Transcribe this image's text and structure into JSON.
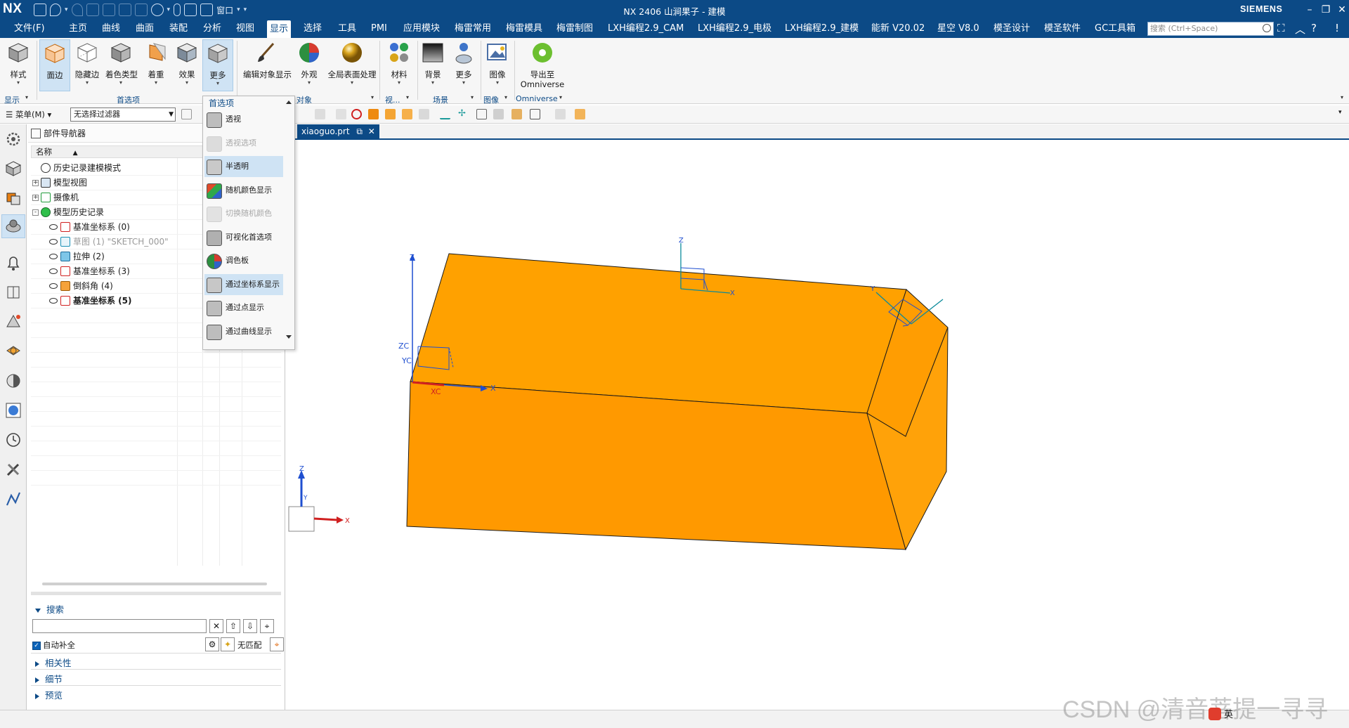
{
  "app": {
    "logo": "NX",
    "window_title": "NX 2406 山涧果子 - 建模",
    "brand": "SIEMENS",
    "window_menu": "窗口"
  },
  "menubar": {
    "items": [
      "文件(F)",
      "主页",
      "曲线",
      "曲面",
      "装配",
      "分析",
      "视图",
      "显示",
      "选择",
      "工具",
      "PMI",
      "应用模块",
      "梅雷常用",
      "梅雷模具",
      "梅雷制图",
      "LXH编程2.9_CAM",
      "LXH编程2.9_电极",
      "LXH编程2.9_建模",
      "能新 V20.02",
      "星空 V8.0",
      "模圣设计",
      "模圣软件",
      "GC工具箱"
    ],
    "active_index": 7,
    "search_placeholder": "搜索 (Ctrl+Space)"
  },
  "ribbon": {
    "buttons": [
      {
        "label": "样式",
        "icon": "style-cube-icon"
      },
      {
        "label": "面边",
        "icon": "face-edge-icon"
      },
      {
        "label": "隐藏边",
        "icon": "hidden-edge-icon"
      },
      {
        "label": "着色类型",
        "icon": "shading-type-icon"
      },
      {
        "label": "着重",
        "icon": "emphasis-icon"
      },
      {
        "label": "效果",
        "icon": "effects-icon"
      },
      {
        "label": "更多",
        "icon": "more-cube-icon"
      },
      {
        "label": "编辑对象显示",
        "icon": "brush-icon"
      },
      {
        "label": "外观",
        "icon": "appearance-pie-icon"
      },
      {
        "label": "全局表面处理",
        "icon": "gold-sphere-icon"
      },
      {
        "label": "材料",
        "icon": "materials-icon"
      },
      {
        "label": "背景",
        "icon": "background-icon"
      },
      {
        "label": "更多",
        "icon": "more-person-icon"
      },
      {
        "label": "图像",
        "icon": "image-icon"
      },
      {
        "label": "导出至",
        "label2": "Omniverse",
        "icon": "omniverse-icon"
      }
    ],
    "groups": [
      "显示",
      "首选项",
      "对象",
      "视...",
      "场景",
      "图像",
      "Omniverse"
    ]
  },
  "toolbar2": {
    "menu_label": "菜单(M)",
    "filter_value": "无选择过滤器"
  },
  "navigator": {
    "title": "部件导航器",
    "column_header": "名称",
    "rows": [
      {
        "label": "历史记录建模模式",
        "icon": "clock-icon",
        "level": 0,
        "expander": "",
        "style": ""
      },
      {
        "label": "模型视图",
        "icon": "model-view-icon",
        "level": 0,
        "expander": "+",
        "style": ""
      },
      {
        "label": "摄像机",
        "icon": "camera-check-icon",
        "level": 0,
        "expander": "+",
        "style": ""
      },
      {
        "label": "模型历史记录",
        "icon": "history-ball-icon",
        "level": 0,
        "expander": "-",
        "style": ""
      },
      {
        "label": "基准坐标系 (0)",
        "icon": "datum-csys-icon",
        "level": 1,
        "expander": "",
        "style": ""
      },
      {
        "label": "草图 (1) \"SKETCH_000\"",
        "icon": "sketch-icon",
        "level": 1,
        "expander": "",
        "style": "dim"
      },
      {
        "label": "拉伸 (2)",
        "icon": "extrude-icon",
        "level": 1,
        "expander": "",
        "style": ""
      },
      {
        "label": "基准坐标系 (3)",
        "icon": "datum-csys-icon",
        "level": 1,
        "expander": "",
        "style": ""
      },
      {
        "label": "倒斜角 (4)",
        "icon": "chamfer-icon",
        "level": 1,
        "expander": "",
        "style": ""
      },
      {
        "label": "基准坐标系 (5)",
        "icon": "datum-csys-icon",
        "level": 1,
        "expander": "",
        "style": "bold"
      }
    ],
    "search_section": "搜索",
    "auto_complete": "自动补全",
    "no_match": "无匹配",
    "sections": [
      "相关性",
      "细节",
      "预览"
    ]
  },
  "document": {
    "tab_label": "xiaoguo.prt"
  },
  "dropdown": {
    "title": "首选项",
    "items": [
      {
        "label": "透视",
        "icon": "perspective-cube-icon",
        "state": "normal"
      },
      {
        "label": "透视选项",
        "icon": "perspective-options-icon",
        "state": "disabled"
      },
      {
        "label": "半透明",
        "icon": "translucent-cube-icon",
        "state": "highlight"
      },
      {
        "label": "随机颜色显示",
        "icon": "random-color-icon",
        "state": "normal"
      },
      {
        "label": "切换随机颜色",
        "icon": "toggle-random-color-icon",
        "state": "disabled"
      },
      {
        "label": "可视化首选项",
        "icon": "visual-prefs-icon",
        "state": "normal"
      },
      {
        "label": "调色板",
        "icon": "palette-icon",
        "state": "normal"
      },
      {
        "label": "通过坐标系显示",
        "icon": "display-by-csys-icon",
        "state": "highlight"
      },
      {
        "label": "通过点显示",
        "icon": "display-by-point-icon",
        "state": "normal"
      },
      {
        "label": "通过曲线显示",
        "icon": "display-by-curve-icon",
        "state": "normal"
      }
    ]
  },
  "viewport": {
    "axis_labels": {
      "x": "X",
      "y": "Y",
      "z": "Z",
      "xc": "XC",
      "yc": "YC",
      "zc": "ZC"
    }
  },
  "colors": {
    "title_bar": "#0c4a86",
    "body_top": "#ffa100",
    "body_front": "#ff9900",
    "body_side": "#ffa209",
    "body_chamfer": "#ff9d02"
  },
  "watermark": "CSDN @清音菩提一寻寻",
  "ime": {
    "lang": "英"
  }
}
